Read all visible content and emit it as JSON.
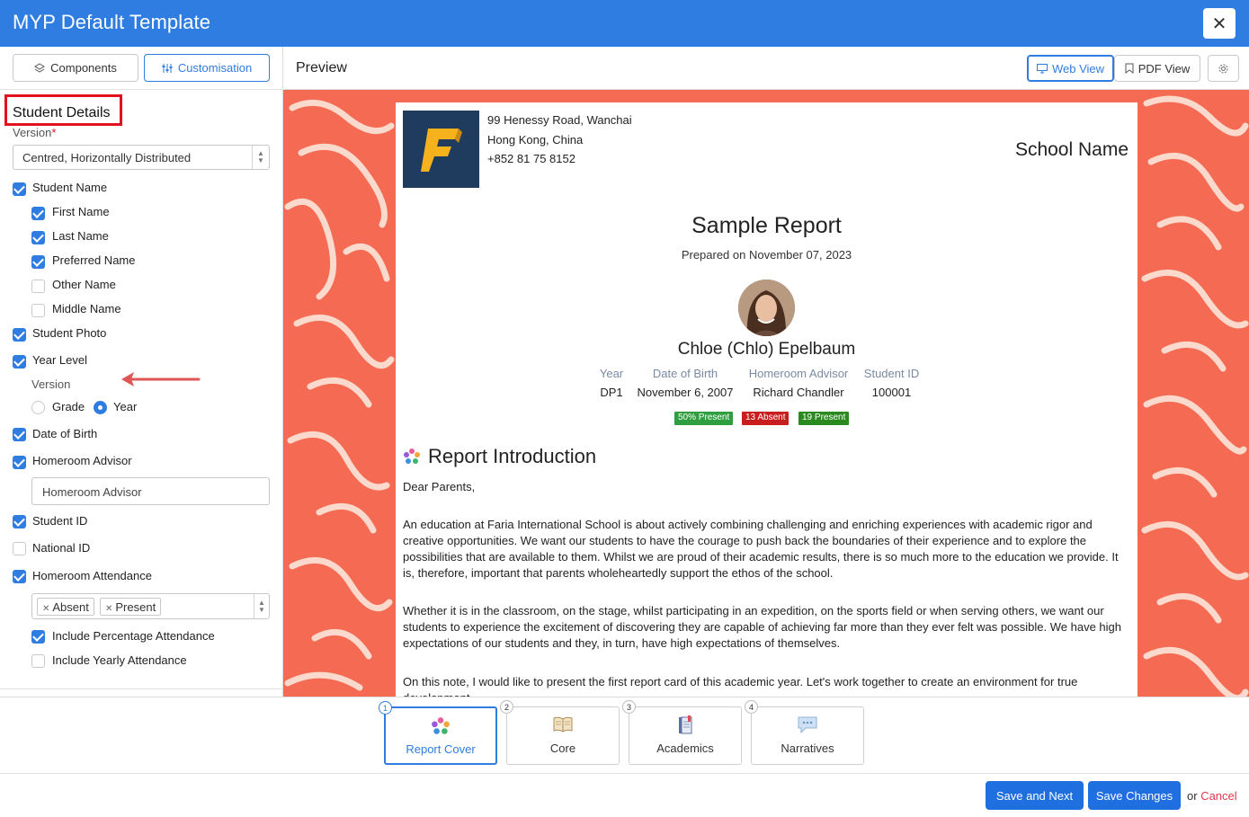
{
  "window": {
    "title": "MYP Default Template",
    "close_label": "✕"
  },
  "left_panel": {
    "tabs": [
      {
        "label": "Components",
        "icon": "layers-icon"
      },
      {
        "label": "Customisation",
        "icon": "sliders-icon"
      }
    ],
    "section_title": "Student Details",
    "version_label": "Version",
    "required_mark": "*",
    "version_value": "Centred, Horizontally Distributed",
    "options": {
      "student_name": "Student Name",
      "first_name": "First Name",
      "last_name": "Last Name",
      "preferred_name": "Preferred Name",
      "other_name": "Other Name",
      "middle_name": "Middle Name",
      "student_photo": "Student Photo",
      "year_level": "Year Level",
      "year_version_label": "Version",
      "grade": "Grade",
      "year": "Year",
      "date_of_birth": "Date of Birth",
      "homeroom_advisor": "Homeroom Advisor",
      "homeroom_advisor_input": "Homeroom Advisor",
      "student_id": "Student ID",
      "national_id": "National ID",
      "homeroom_attendance": "Homeroom Attendance",
      "attendance_tags": [
        "Absent",
        "Present"
      ],
      "include_percentage": "Include Percentage Attendance",
      "include_yearly": "Include Yearly Attendance"
    }
  },
  "preview": {
    "title": "Preview",
    "web_view": "Web View",
    "pdf_view": "PDF View",
    "address": [
      "99 Henessy Road, Wanchai",
      "Hong Kong, China",
      "+852 81 75 8152"
    ],
    "school_name": "School Name",
    "report_title": "Sample Report",
    "prepared": "Prepared on November 07, 2023",
    "student_name": "Chloe (Chlo) Epelbaum",
    "details": [
      {
        "label": "Year",
        "value": "DP1"
      },
      {
        "label": "Date of Birth",
        "value": "November 6, 2007"
      },
      {
        "label": "Homeroom Advisor",
        "value": "Richard Chandler"
      },
      {
        "label": "Student ID",
        "value": "100001"
      }
    ],
    "badges": [
      {
        "text": "50% Present",
        "color": "#2e9e3e"
      },
      {
        "text": "13 Absent",
        "color": "#c81e1e"
      },
      {
        "text": "19 Present",
        "color": "#2a8a1f"
      }
    ],
    "section_title": "Report Introduction",
    "paragraphs": [
      "Dear Parents,",
      "An education at Faria International School is about actively combining challenging and enriching experiences with academic rigor and creative opportunities. We want our students to have the courage to push back the boundaries of their experience and to explore the possibilities that are available to them. Whilst we are proud of their academic results, there is so much more to the education we provide. It is, therefore, important that parents wholeheartedly support the ethos of the school.",
      "Whether it is in the classroom, on the stage, whilst participating in an expedition, on the sports field or when serving others, we want our students to experience the excitement of discovering they are capable of achieving far more than they ever felt was possible. We have high expectations of our students and they, in turn, have high expectations of themselves.",
      "On this note, I would like to present the first report card of this academic year. Let's work together to create an environment for true development."
    ]
  },
  "page_tabs": [
    {
      "num": "1",
      "label": "Report Cover",
      "icon": "star-cluster-icon"
    },
    {
      "num": "2",
      "label": "Core",
      "icon": "book-icon"
    },
    {
      "num": "3",
      "label": "Academics",
      "icon": "notebook-icon"
    },
    {
      "num": "4",
      "label": "Narratives",
      "icon": "speech-bubble-icon"
    }
  ],
  "footer": {
    "save_next": "Save and Next",
    "save_changes": "Save Changes",
    "or": "or",
    "cancel": "Cancel"
  },
  "colors": {
    "accent": "#2f7de1",
    "pattern_bg": "#f46a52",
    "highlight_border": "#e4101d"
  }
}
